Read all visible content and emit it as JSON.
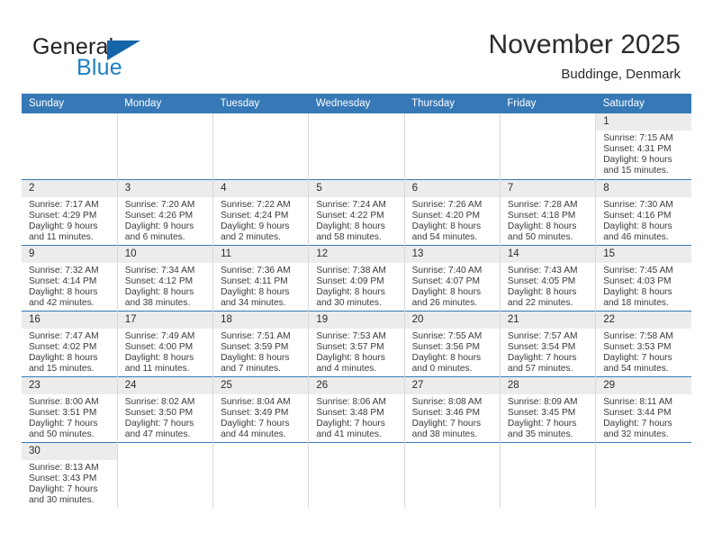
{
  "logo": {
    "word_top": "General",
    "word_bottom": "Blue",
    "flag_icon": "triangle-flag-icon",
    "color_top": "#231f20",
    "color_bottom": "#1f7fc4",
    "color_flag": "#1565a8"
  },
  "header": {
    "title": "November 2025",
    "subtitle": "Buddinge, Denmark"
  },
  "theme": {
    "header_row_bg": "#3679b6",
    "daynum_bg": "#ececec",
    "grid_line": "#d8d8d8",
    "row_divider": "#3679b6"
  },
  "calendar": {
    "weekday_headers": [
      "Sunday",
      "Monday",
      "Tuesday",
      "Wednesday",
      "Thursday",
      "Friday",
      "Saturday"
    ],
    "weeks": [
      [
        {
          "day": "",
          "lines": []
        },
        {
          "day": "",
          "lines": []
        },
        {
          "day": "",
          "lines": []
        },
        {
          "day": "",
          "lines": []
        },
        {
          "day": "",
          "lines": []
        },
        {
          "day": "",
          "lines": []
        },
        {
          "day": "1",
          "lines": [
            "Sunrise: 7:15 AM",
            "Sunset: 4:31 PM",
            "Daylight: 9 hours",
            "and 15 minutes."
          ]
        }
      ],
      [
        {
          "day": "2",
          "lines": [
            "Sunrise: 7:17 AM",
            "Sunset: 4:29 PM",
            "Daylight: 9 hours",
            "and 11 minutes."
          ]
        },
        {
          "day": "3",
          "lines": [
            "Sunrise: 7:20 AM",
            "Sunset: 4:26 PM",
            "Daylight: 9 hours",
            "and 6 minutes."
          ]
        },
        {
          "day": "4",
          "lines": [
            "Sunrise: 7:22 AM",
            "Sunset: 4:24 PM",
            "Daylight: 9 hours",
            "and 2 minutes."
          ]
        },
        {
          "day": "5",
          "lines": [
            "Sunrise: 7:24 AM",
            "Sunset: 4:22 PM",
            "Daylight: 8 hours",
            "and 58 minutes."
          ]
        },
        {
          "day": "6",
          "lines": [
            "Sunrise: 7:26 AM",
            "Sunset: 4:20 PM",
            "Daylight: 8 hours",
            "and 54 minutes."
          ]
        },
        {
          "day": "7",
          "lines": [
            "Sunrise: 7:28 AM",
            "Sunset: 4:18 PM",
            "Daylight: 8 hours",
            "and 50 minutes."
          ]
        },
        {
          "day": "8",
          "lines": [
            "Sunrise: 7:30 AM",
            "Sunset: 4:16 PM",
            "Daylight: 8 hours",
            "and 46 minutes."
          ]
        }
      ],
      [
        {
          "day": "9",
          "lines": [
            "Sunrise: 7:32 AM",
            "Sunset: 4:14 PM",
            "Daylight: 8 hours",
            "and 42 minutes."
          ]
        },
        {
          "day": "10",
          "lines": [
            "Sunrise: 7:34 AM",
            "Sunset: 4:12 PM",
            "Daylight: 8 hours",
            "and 38 minutes."
          ]
        },
        {
          "day": "11",
          "lines": [
            "Sunrise: 7:36 AM",
            "Sunset: 4:11 PM",
            "Daylight: 8 hours",
            "and 34 minutes."
          ]
        },
        {
          "day": "12",
          "lines": [
            "Sunrise: 7:38 AM",
            "Sunset: 4:09 PM",
            "Daylight: 8 hours",
            "and 30 minutes."
          ]
        },
        {
          "day": "13",
          "lines": [
            "Sunrise: 7:40 AM",
            "Sunset: 4:07 PM",
            "Daylight: 8 hours",
            "and 26 minutes."
          ]
        },
        {
          "day": "14",
          "lines": [
            "Sunrise: 7:43 AM",
            "Sunset: 4:05 PM",
            "Daylight: 8 hours",
            "and 22 minutes."
          ]
        },
        {
          "day": "15",
          "lines": [
            "Sunrise: 7:45 AM",
            "Sunset: 4:03 PM",
            "Daylight: 8 hours",
            "and 18 minutes."
          ]
        }
      ],
      [
        {
          "day": "16",
          "lines": [
            "Sunrise: 7:47 AM",
            "Sunset: 4:02 PM",
            "Daylight: 8 hours",
            "and 15 minutes."
          ]
        },
        {
          "day": "17",
          "lines": [
            "Sunrise: 7:49 AM",
            "Sunset: 4:00 PM",
            "Daylight: 8 hours",
            "and 11 minutes."
          ]
        },
        {
          "day": "18",
          "lines": [
            "Sunrise: 7:51 AM",
            "Sunset: 3:59 PM",
            "Daylight: 8 hours",
            "and 7 minutes."
          ]
        },
        {
          "day": "19",
          "lines": [
            "Sunrise: 7:53 AM",
            "Sunset: 3:57 PM",
            "Daylight: 8 hours",
            "and 4 minutes."
          ]
        },
        {
          "day": "20",
          "lines": [
            "Sunrise: 7:55 AM",
            "Sunset: 3:56 PM",
            "Daylight: 8 hours",
            "and 0 minutes."
          ]
        },
        {
          "day": "21",
          "lines": [
            "Sunrise: 7:57 AM",
            "Sunset: 3:54 PM",
            "Daylight: 7 hours",
            "and 57 minutes."
          ]
        },
        {
          "day": "22",
          "lines": [
            "Sunrise: 7:58 AM",
            "Sunset: 3:53 PM",
            "Daylight: 7 hours",
            "and 54 minutes."
          ]
        }
      ],
      [
        {
          "day": "23",
          "lines": [
            "Sunrise: 8:00 AM",
            "Sunset: 3:51 PM",
            "Daylight: 7 hours",
            "and 50 minutes."
          ]
        },
        {
          "day": "24",
          "lines": [
            "Sunrise: 8:02 AM",
            "Sunset: 3:50 PM",
            "Daylight: 7 hours",
            "and 47 minutes."
          ]
        },
        {
          "day": "25",
          "lines": [
            "Sunrise: 8:04 AM",
            "Sunset: 3:49 PM",
            "Daylight: 7 hours",
            "and 44 minutes."
          ]
        },
        {
          "day": "26",
          "lines": [
            "Sunrise: 8:06 AM",
            "Sunset: 3:48 PM",
            "Daylight: 7 hours",
            "and 41 minutes."
          ]
        },
        {
          "day": "27",
          "lines": [
            "Sunrise: 8:08 AM",
            "Sunset: 3:46 PM",
            "Daylight: 7 hours",
            "and 38 minutes."
          ]
        },
        {
          "day": "28",
          "lines": [
            "Sunrise: 8:09 AM",
            "Sunset: 3:45 PM",
            "Daylight: 7 hours",
            "and 35 minutes."
          ]
        },
        {
          "day": "29",
          "lines": [
            "Sunrise: 8:11 AM",
            "Sunset: 3:44 PM",
            "Daylight: 7 hours",
            "and 32 minutes."
          ]
        }
      ],
      [
        {
          "day": "30",
          "lines": [
            "Sunrise: 8:13 AM",
            "Sunset: 3:43 PM",
            "Daylight: 7 hours",
            "and 30 minutes."
          ]
        },
        {
          "day": "",
          "lines": []
        },
        {
          "day": "",
          "lines": []
        },
        {
          "day": "",
          "lines": []
        },
        {
          "day": "",
          "lines": []
        },
        {
          "day": "",
          "lines": []
        },
        {
          "day": "",
          "lines": []
        }
      ]
    ]
  }
}
